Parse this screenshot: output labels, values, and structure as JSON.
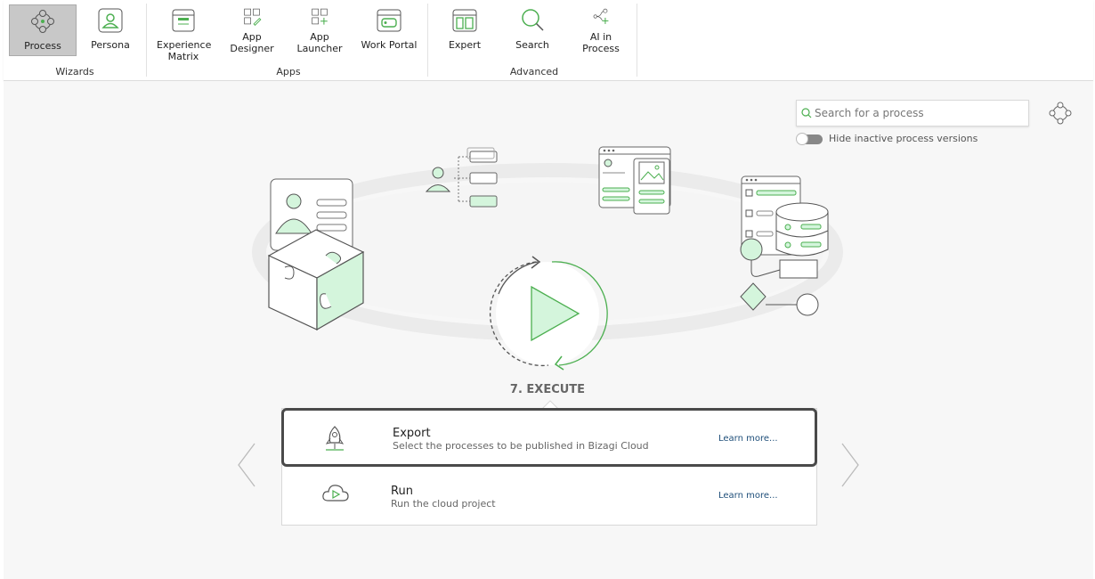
{
  "ribbon": {
    "groups": [
      {
        "label": "Wizards"
      },
      {
        "label": "Apps"
      },
      {
        "label": "Advanced"
      }
    ],
    "buttons": [
      {
        "label": "Process",
        "icon": "process-icon",
        "active": true
      },
      {
        "label": "Persona",
        "icon": "persona-icon"
      },
      {
        "label": "Experience Matrix",
        "icon": "experience-matrix-icon"
      },
      {
        "label": "App Designer",
        "icon": "app-designer-icon"
      },
      {
        "label": "App Launcher",
        "icon": "app-launcher-icon"
      },
      {
        "label": "Work Portal",
        "icon": "work-portal-icon"
      },
      {
        "label": "Expert",
        "icon": "expert-icon"
      },
      {
        "label": "Search",
        "icon": "search-icon"
      },
      {
        "label": "AI in Process",
        "icon": "ai-in-process-icon"
      }
    ]
  },
  "search": {
    "placeholder": "Search for a process"
  },
  "toggle": {
    "label": "Hide inactive process versions",
    "on": false
  },
  "step": {
    "title": "7. EXECUTE"
  },
  "cards": [
    {
      "title": "Export",
      "subtitle": "Select the processes to be published in Bizagi Cloud",
      "link": "Learn more...",
      "icon": "rocket-icon",
      "selected": true
    },
    {
      "title": "Run",
      "subtitle": "Run the cloud project",
      "link": "Learn more...",
      "icon": "cloud-play-icon",
      "selected": false
    }
  ],
  "colors": {
    "accent": "#4caf50",
    "accent_light": "#d4f5dc",
    "selected_border": "#4a4a4a"
  }
}
